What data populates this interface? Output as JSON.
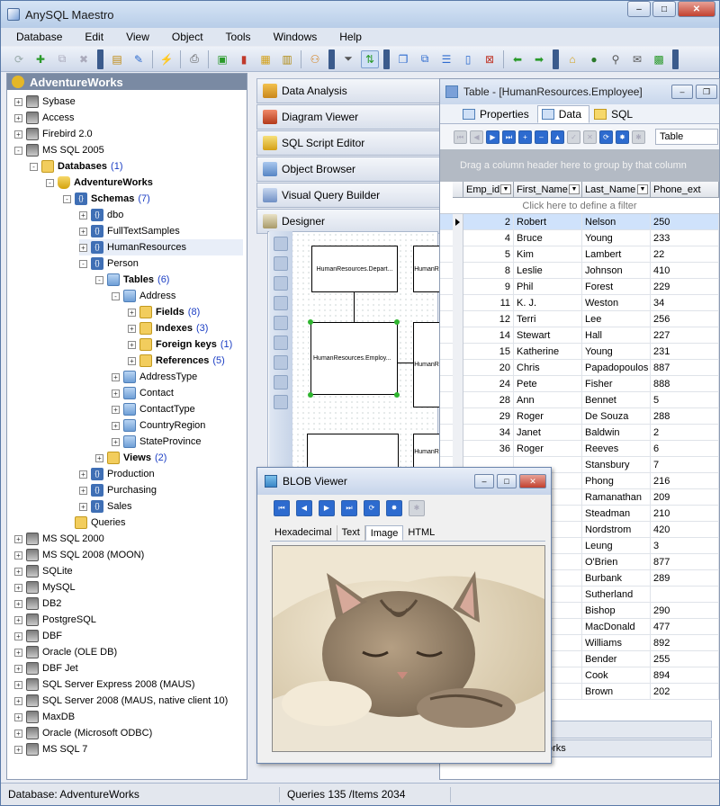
{
  "app": {
    "title": "AnySQL Maestro"
  },
  "menu": [
    "Database",
    "Edit",
    "View",
    "Object",
    "Tools",
    "Windows",
    "Help"
  ],
  "explorer": {
    "header": "AdventureWorks",
    "nodes": [
      {
        "label": "Sybase",
        "kind": "server",
        "level": 0,
        "exp": "+"
      },
      {
        "label": "Access",
        "kind": "server",
        "level": 0,
        "exp": "+"
      },
      {
        "label": "Firebird 2.0",
        "kind": "server",
        "level": 0,
        "exp": "+"
      },
      {
        "label": "MS SQL 2005",
        "kind": "server",
        "level": 0,
        "exp": "-"
      },
      {
        "label": "Databases",
        "count": "(1)",
        "kind": "folder",
        "level": 1,
        "exp": "-",
        "bold": true
      },
      {
        "label": "AdventureWorks",
        "kind": "db",
        "level": 2,
        "exp": "-",
        "bold": true
      },
      {
        "label": "Schemas",
        "count": "(7)",
        "kind": "schema",
        "level": 3,
        "exp": "-",
        "bold": true
      },
      {
        "label": "dbo",
        "kind": "schema",
        "level": 4,
        "exp": "+"
      },
      {
        "label": "FullTextSamples",
        "kind": "schema",
        "level": 4,
        "exp": "+"
      },
      {
        "label": "HumanResources",
        "kind": "schema",
        "level": 4,
        "exp": "+",
        "selected": true
      },
      {
        "label": "Person",
        "kind": "schema",
        "level": 4,
        "exp": "-"
      },
      {
        "label": "Tables",
        "count": "(6)",
        "kind": "table",
        "level": 5,
        "exp": "-",
        "bold": true
      },
      {
        "label": "Address",
        "kind": "table",
        "level": 6,
        "exp": "-"
      },
      {
        "label": "Fields",
        "count": "(8)",
        "kind": "folder",
        "level": 7,
        "exp": "+",
        "bold": true
      },
      {
        "label": "Indexes",
        "count": "(3)",
        "kind": "folder",
        "level": 7,
        "exp": "+",
        "bold": true
      },
      {
        "label": "Foreign keys",
        "count": "(1)",
        "kind": "folder",
        "level": 7,
        "exp": "+",
        "bold": true
      },
      {
        "label": "References",
        "count": "(5)",
        "kind": "folder",
        "level": 7,
        "exp": "+",
        "bold": true
      },
      {
        "label": "AddressType",
        "kind": "table",
        "level": 6,
        "exp": "+"
      },
      {
        "label": "Contact",
        "kind": "table",
        "level": 6,
        "exp": "+"
      },
      {
        "label": "ContactType",
        "kind": "table",
        "level": 6,
        "exp": "+"
      },
      {
        "label": "CountryRegion",
        "kind": "table",
        "level": 6,
        "exp": "+"
      },
      {
        "label": "StateProvince",
        "kind": "table",
        "level": 6,
        "exp": "+"
      },
      {
        "label": "Views",
        "count": "(2)",
        "kind": "folder",
        "level": 5,
        "exp": "+",
        "bold": true
      },
      {
        "label": "Production",
        "kind": "schema",
        "level": 4,
        "exp": "+"
      },
      {
        "label": "Purchasing",
        "kind": "schema",
        "level": 4,
        "exp": "+"
      },
      {
        "label": "Sales",
        "kind": "schema",
        "level": 4,
        "exp": "+"
      },
      {
        "label": "Queries",
        "kind": "folder",
        "level": 3,
        "exp": ""
      },
      {
        "label": "MS SQL 2000",
        "kind": "server",
        "level": 0,
        "exp": "+"
      },
      {
        "label": "MS SQL 2008 (MOON)",
        "kind": "server",
        "level": 0,
        "exp": "+"
      },
      {
        "label": "SQLite",
        "kind": "server",
        "level": 0,
        "exp": "+"
      },
      {
        "label": "MySQL",
        "kind": "server",
        "level": 0,
        "exp": "+"
      },
      {
        "label": "DB2",
        "kind": "server",
        "level": 0,
        "exp": "+"
      },
      {
        "label": "PostgreSQL",
        "kind": "server",
        "level": 0,
        "exp": "+"
      },
      {
        "label": "DBF",
        "kind": "server",
        "level": 0,
        "exp": "+"
      },
      {
        "label": "Oracle (OLE DB)",
        "kind": "server",
        "level": 0,
        "exp": "+"
      },
      {
        "label": "DBF Jet",
        "kind": "server",
        "level": 0,
        "exp": "+"
      },
      {
        "label": "SQL Server Express 2008 (MAUS)",
        "kind": "server",
        "level": 0,
        "exp": "+"
      },
      {
        "label": "SQL Server 2008 (MAUS, native client 10)",
        "kind": "server",
        "level": 0,
        "exp": "+"
      },
      {
        "label": "MaxDB",
        "kind": "server",
        "level": 0,
        "exp": "+"
      },
      {
        "label": "Oracle (Microsoft ODBC)",
        "kind": "server",
        "level": 0,
        "exp": "+"
      },
      {
        "label": "MS SQL 7",
        "kind": "server",
        "level": 0,
        "exp": "+"
      }
    ]
  },
  "center_tabs": [
    "Data Analysis",
    "Diagram Viewer",
    "SQL Script Editor",
    "Object Browser",
    "Visual Query Builder",
    "Designer"
  ],
  "designer": {
    "entities": [
      "HumanResources.Depart...",
      "HumanR",
      "HumanResources.Employ...",
      "HumanR",
      "HumanR"
    ]
  },
  "table_window": {
    "title": "Table - [HumanResources.Employee]",
    "tabs": [
      "Properties",
      "Data",
      "SQL"
    ],
    "active_tab": "Data",
    "view_select": "Table",
    "group_hint": "Drag a column header here to group by that column",
    "filter_hint": "Click here to define a filter",
    "columns": [
      "Emp_id",
      "First_Name",
      "Last_Name",
      "Phone_ext"
    ],
    "rows": [
      [
        "2",
        "Robert",
        "Nelson",
        "250"
      ],
      [
        "4",
        "Bruce",
        "Young",
        "233"
      ],
      [
        "5",
        "Kim",
        "Lambert",
        "22"
      ],
      [
        "8",
        "Leslie",
        "Johnson",
        "410"
      ],
      [
        "9",
        "Phil",
        "Forest",
        "229"
      ],
      [
        "11",
        "K. J.",
        "Weston",
        "34"
      ],
      [
        "12",
        "Terri",
        "Lee",
        "256"
      ],
      [
        "14",
        "Stewart",
        "Hall",
        "227"
      ],
      [
        "15",
        "Katherine",
        "Young",
        "231"
      ],
      [
        "20",
        "Chris",
        "Papadopoulos",
        "887"
      ],
      [
        "24",
        "Pete",
        "Fisher",
        "888"
      ],
      [
        "28",
        "Ann",
        "Bennet",
        "5"
      ],
      [
        "29",
        "Roger",
        "De Souza",
        "288"
      ],
      [
        "34",
        "Janet",
        "Baldwin",
        "2"
      ],
      [
        "36",
        "Roger",
        "Reeves",
        "6"
      ],
      [
        "",
        "",
        "Stansbury",
        "7"
      ],
      [
        "",
        "",
        "Phong",
        "216"
      ],
      [
        "",
        "",
        "Ramanathan",
        "209"
      ],
      [
        "",
        "",
        "Steadman",
        "210"
      ],
      [
        "",
        "",
        "Nordstrom",
        "420"
      ],
      [
        "",
        "",
        "Leung",
        "3"
      ],
      [
        "",
        "e",
        "O'Brien",
        "877"
      ],
      [
        "",
        "M.",
        "Burbank",
        "289"
      ],
      [
        "",
        "",
        "Sutherland",
        ""
      ],
      [
        "",
        "",
        "Bishop",
        "290"
      ],
      [
        "",
        "",
        "MacDonald",
        "477"
      ],
      [
        "",
        "",
        "Williams",
        "892"
      ],
      [
        "",
        "",
        "Bender",
        "255"
      ],
      [
        "",
        "",
        "Cook",
        "894"
      ],
      [
        "",
        "",
        "Brown",
        "202"
      ]
    ],
    "current_row": 0,
    "bottom_tab_1": "s",
    "bottom_tab_2": "orks"
  },
  "blob_viewer": {
    "title": "BLOB Viewer",
    "tabs": [
      "Hexadecimal",
      "Text",
      "Image",
      "HTML"
    ],
    "active_tab": "Image"
  },
  "status": {
    "database": "Database: AdventureWorks",
    "queries": "Queries 135 /Items 2034"
  }
}
